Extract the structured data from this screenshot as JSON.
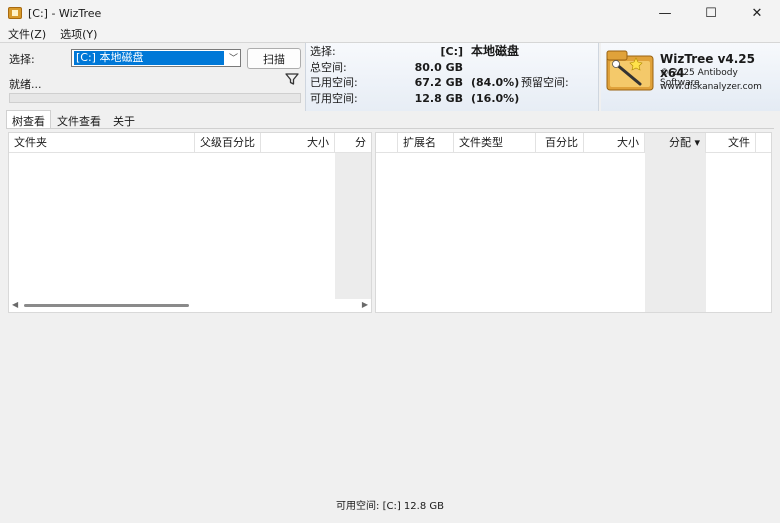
{
  "window": {
    "title": "[C:]  - WizTree",
    "minimize_glyph": "—",
    "maximize_glyph": "☐",
    "close_glyph": "✕"
  },
  "menu": {
    "file": "文件(Z)",
    "options": "选项(Y)"
  },
  "scan": {
    "select_label": "选择:",
    "drive_value": "[C:] 本地磁盘",
    "scan_button": "扫描",
    "status": "就绪..."
  },
  "info": {
    "select_label": "选择:",
    "drive_letter": "[C:]",
    "drive_name": "本地磁盘",
    "total_label": "总空间:",
    "total_value": "80.0 GB",
    "used_label": "已用空间:",
    "used_value": "67.2 GB",
    "used_pct": "(84.0%)",
    "reserved_label": "预留空间:",
    "free_label": "可用空间:",
    "free_value": "12.8 GB",
    "free_pct": "(16.0%)"
  },
  "brand": {
    "title": "WizTree v4.25 x64",
    "copyright": "© 2025 Antibody Software",
    "url": "www.diskanalyzer.com"
  },
  "tabs": [
    "树查看",
    "文件查看",
    "关于"
  ],
  "tree_columns": [
    "文件夹",
    "父级百分比",
    "大小",
    "分"
  ],
  "ext_columns": [
    "扩展名",
    "文件类型",
    "百分比",
    "大小",
    "分配 ▾",
    "文件"
  ],
  "statusbar": "可用空间: [C:] 12.8 GB",
  "colors": {
    "selection": "#0078d7",
    "panel_bg": "#f0f0f0",
    "info_bg": "#e7edf5"
  }
}
